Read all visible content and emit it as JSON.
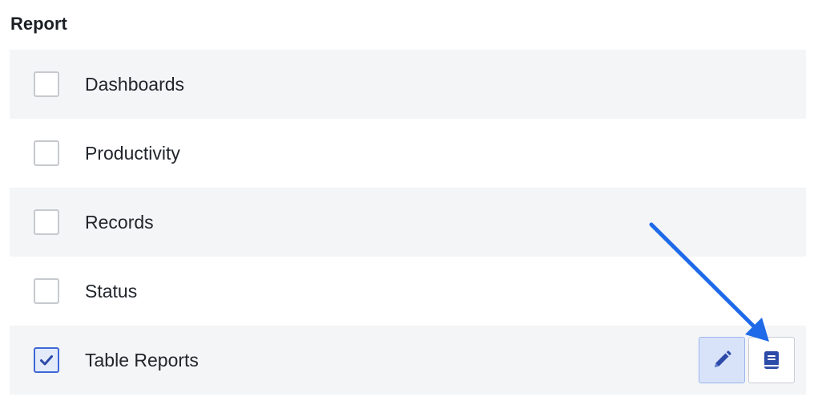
{
  "section": {
    "title": "Report"
  },
  "items": [
    {
      "label": "Dashboards",
      "checked": false
    },
    {
      "label": "Productivity",
      "checked": false
    },
    {
      "label": "Records",
      "checked": false
    },
    {
      "label": "Status",
      "checked": false
    },
    {
      "label": "Table Reports",
      "checked": true
    }
  ],
  "actions": {
    "edit_icon": "pencil-icon",
    "book_icon": "book-icon"
  },
  "colors": {
    "accent": "#3f67d6",
    "accent_dark": "#2c4aa8",
    "arrow": "#1f6ae8",
    "row_shade": "#f4f5f7"
  }
}
